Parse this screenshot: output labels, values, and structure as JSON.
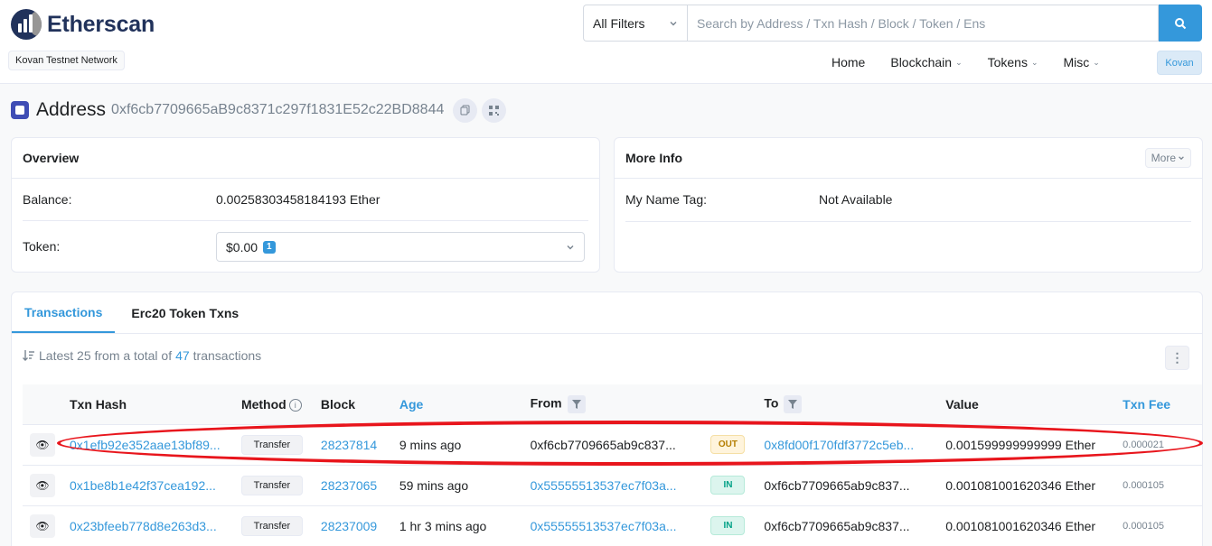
{
  "header": {
    "logo_text": "Etherscan",
    "network": "Kovan Testnet Network",
    "filter_label": "All Filters",
    "search_placeholder": "Search by Address / Txn Hash / Block / Token / Ens",
    "nav": [
      "Home",
      "Blockchain",
      "Tokens",
      "Misc"
    ],
    "network_button": "Kovan"
  },
  "address": {
    "title": "Address",
    "hash": "0xf6cb7709665aB9c8371c297f1831E52c22BD8844"
  },
  "overview": {
    "title": "Overview",
    "balance_label": "Balance:",
    "balance_value": "0.00258303458184193 Ether",
    "token_label": "Token:",
    "token_value": "$0.00",
    "token_count": "1"
  },
  "more_info": {
    "title": "More Info",
    "more_button": "More",
    "name_tag_label": "My Name Tag:",
    "name_tag_value": "Not Available"
  },
  "tabs": [
    "Transactions",
    "Erc20 Token Txns"
  ],
  "summary": {
    "prefix": "Latest 25 from a total of",
    "count": "47",
    "suffix": "transactions"
  },
  "table": {
    "columns": [
      "Txn Hash",
      "Method",
      "Block",
      "Age",
      "From",
      "To",
      "Value",
      "Txn Fee"
    ],
    "rows": [
      {
        "hash": "0x1efb92e352aae13bf89...",
        "method": "Transfer",
        "block": "28237814",
        "age": "9 mins ago",
        "from": "0xf6cb7709665ab9c837...",
        "dir": "OUT",
        "to": "0x8fd00f170fdf3772c5eb...",
        "value": "0.001599999999999 Ether",
        "fee": "0.000021"
      },
      {
        "hash": "0x1be8b1e42f37cea192...",
        "method": "Transfer",
        "block": "28237065",
        "age": "59 mins ago",
        "from": "0x55555513537ec7f03a...",
        "dir": "IN",
        "to": "0xf6cb7709665ab9c837...",
        "value": "0.001081001620346 Ether",
        "fee": "0.000105"
      },
      {
        "hash": "0x23bfeeb778d8e263d3...",
        "method": "Transfer",
        "block": "28237009",
        "age": "1 hr 3 mins ago",
        "from": "0x55555513537ec7f03a...",
        "dir": "IN",
        "to": "0xf6cb7709665ab9c837...",
        "value": "0.001081001620346 Ether",
        "fee": "0.000105"
      }
    ]
  },
  "colors": {
    "accent": "#3498db",
    "brand": "#21325b",
    "out_badge": "#fff4dc",
    "in_badge": "#dcf5ee",
    "highlight": "#e8151c"
  },
  "icons": [
    "logo-icon",
    "search-icon",
    "chevron-down-icon",
    "address-icon",
    "copy-icon",
    "qr-code-icon",
    "sort-icon",
    "kebab-icon",
    "eye-icon",
    "filter-icon",
    "info-icon"
  ]
}
